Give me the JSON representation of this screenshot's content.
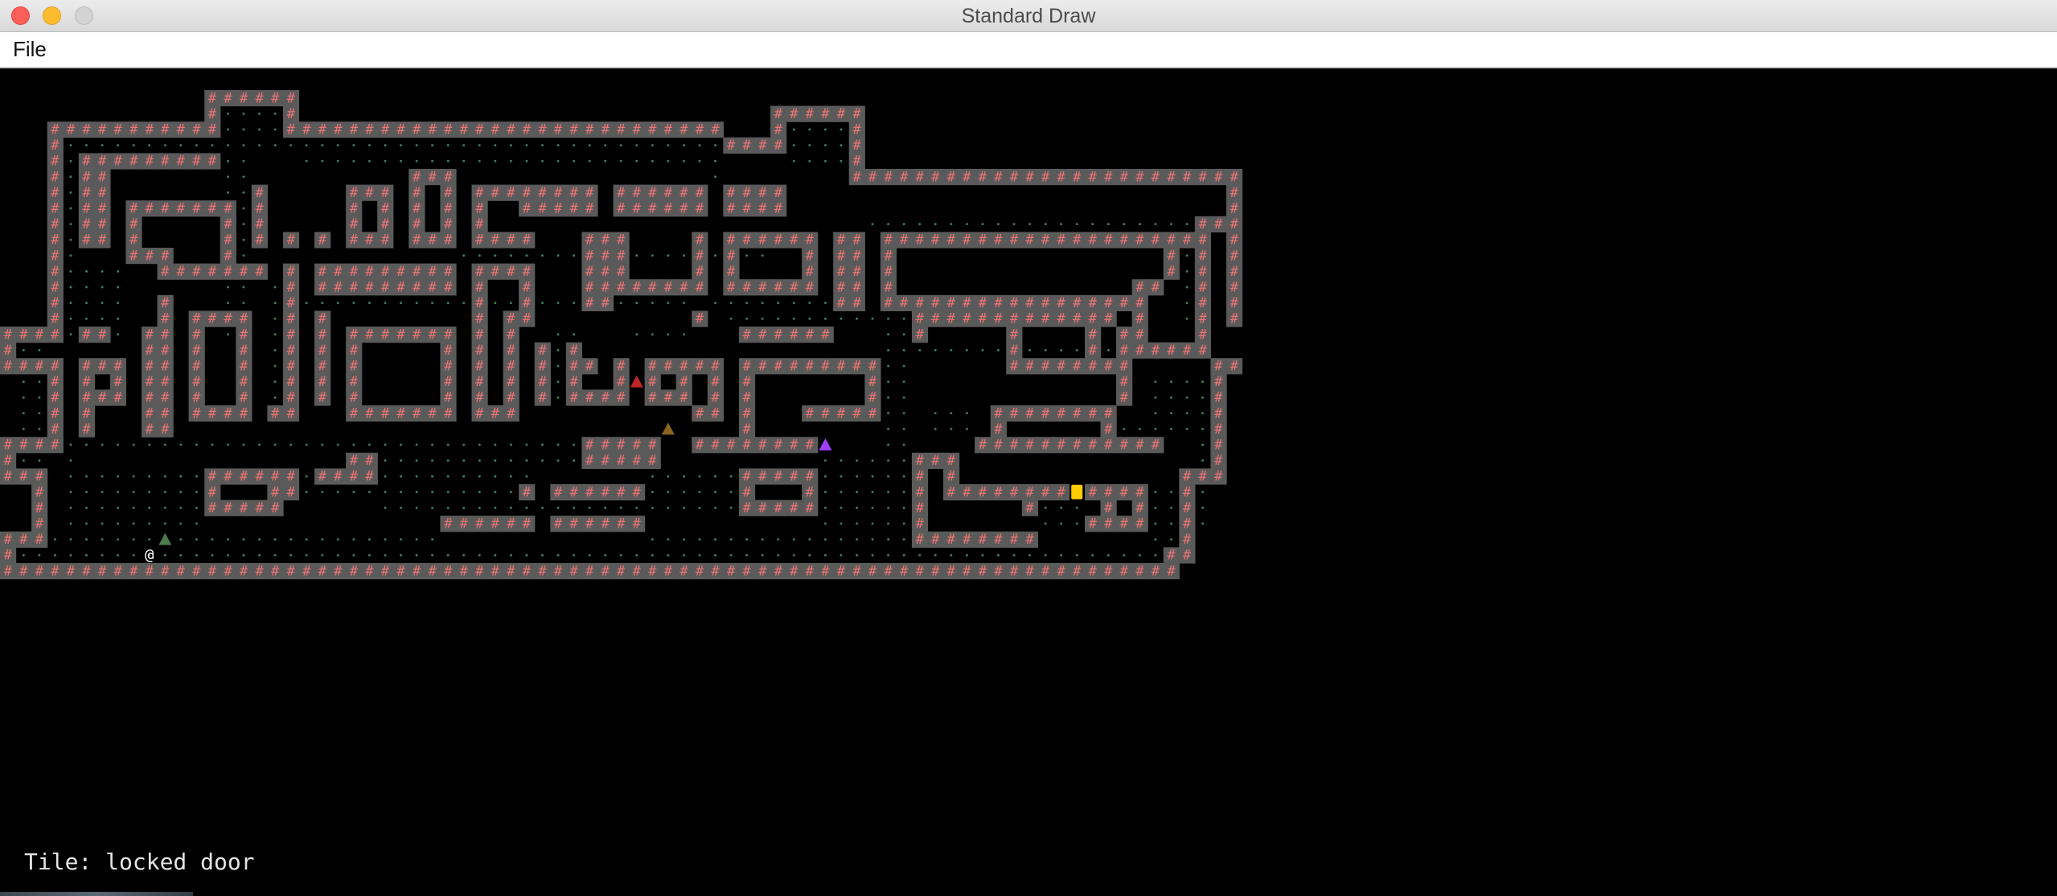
{
  "window": {
    "title": "Standard Draw"
  },
  "menu": {
    "items": [
      {
        "label": "File"
      }
    ]
  },
  "status": {
    "label": "Tile:",
    "value": "locked door",
    "text": "Tile: locked door"
  },
  "colors": {
    "wall_bg": "#5a5a5a",
    "wall_glyph": "#ea7474",
    "floor_dot": "#3d7a55",
    "player": "#ffffff",
    "door": "#ffcc00",
    "enemy_red": "#c02424",
    "enemy_brown": "#8a6420",
    "enemy_purple": "#a040ff",
    "enemy_green": "#4d7a4d"
  },
  "glyphs": {
    "wall": "#",
    "player": "@"
  },
  "map": {
    "cols": 80,
    "rows": 30,
    "rects": [
      [
        13,
        0,
        6,
        1
      ],
      [
        13,
        1,
        1,
        2
      ],
      [
        18,
        1,
        1,
        2
      ],
      [
        3,
        2,
        11,
        1
      ],
      [
        18,
        2,
        28,
        1
      ],
      [
        49,
        1,
        6,
        1
      ],
      [
        49,
        2,
        1,
        2
      ],
      [
        54,
        2,
        1,
        3
      ],
      [
        46,
        3,
        4,
        1
      ],
      [
        54,
        5,
        25,
        1
      ],
      [
        78,
        5,
        1,
        10
      ],
      [
        3,
        3,
        1,
        12
      ],
      [
        5,
        4,
        9,
        1
      ],
      [
        5,
        5,
        2,
        5
      ],
      [
        8,
        7,
        7,
        1
      ],
      [
        8,
        8,
        1,
        3
      ],
      [
        14,
        8,
        1,
        4
      ],
      [
        8,
        10,
        3,
        1
      ],
      [
        10,
        11,
        7,
        1
      ],
      [
        16,
        6,
        1,
        4
      ],
      [
        22,
        6,
        3,
        1
      ],
      [
        22,
        7,
        1,
        3
      ],
      [
        24,
        7,
        1,
        3
      ],
      [
        22,
        9,
        3,
        1
      ],
      [
        26,
        5,
        3,
        1
      ],
      [
        26,
        6,
        1,
        4
      ],
      [
        28,
        6,
        1,
        4
      ],
      [
        26,
        9,
        3,
        1
      ],
      [
        30,
        6,
        8,
        1
      ],
      [
        30,
        7,
        1,
        3
      ],
      [
        33,
        7,
        5,
        1
      ],
      [
        30,
        9,
        4,
        1
      ],
      [
        39,
        6,
        6,
        1
      ],
      [
        39,
        7,
        6,
        1
      ],
      [
        46,
        6,
        4,
        1
      ],
      [
        46,
        7,
        4,
        1
      ],
      [
        18,
        9,
        1,
        1
      ],
      [
        20,
        9,
        1,
        1
      ],
      [
        37,
        9,
        2,
        5
      ],
      [
        39,
        9,
        1,
        4
      ],
      [
        44,
        9,
        1,
        4
      ],
      [
        39,
        12,
        6,
        1
      ],
      [
        46,
        9,
        6,
        1
      ],
      [
        46,
        10,
        1,
        3
      ],
      [
        51,
        10,
        1,
        3
      ],
      [
        46,
        12,
        6,
        1
      ],
      [
        53,
        9,
        2,
        5
      ],
      [
        56,
        9,
        20,
        1
      ],
      [
        56,
        10,
        1,
        4
      ],
      [
        74,
        10,
        1,
        2
      ],
      [
        56,
        13,
        16,
        1
      ],
      [
        76,
        8,
        2,
        1
      ],
      [
        76,
        9,
        1,
        8
      ],
      [
        72,
        12,
        2,
        1
      ],
      [
        72,
        13,
        1,
        4
      ],
      [
        72,
        16,
        4,
        1
      ],
      [
        20,
        11,
        9,
        1
      ],
      [
        20,
        12,
        9,
        1
      ],
      [
        18,
        11,
        1,
        10
      ],
      [
        30,
        11,
        4,
        1
      ],
      [
        30,
        12,
        1,
        9
      ],
      [
        33,
        12,
        1,
        3
      ],
      [
        32,
        14,
        2,
        1
      ],
      [
        32,
        15,
        1,
        6
      ],
      [
        30,
        20,
        3,
        1
      ],
      [
        44,
        14,
        1,
        1
      ],
      [
        0,
        15,
        4,
        1
      ],
      [
        5,
        15,
        2,
        1
      ],
      [
        0,
        16,
        1,
        1
      ],
      [
        0,
        17,
        4,
        1
      ],
      [
        3,
        18,
        1,
        4
      ],
      [
        0,
        22,
        4,
        1
      ],
      [
        5,
        17,
        3,
        1
      ],
      [
        5,
        18,
        1,
        1
      ],
      [
        7,
        18,
        1,
        1
      ],
      [
        5,
        19,
        3,
        1
      ],
      [
        5,
        20,
        1,
        2
      ],
      [
        10,
        13,
        1,
        9
      ],
      [
        9,
        15,
        2,
        7
      ],
      [
        12,
        14,
        4,
        1
      ],
      [
        12,
        15,
        1,
        6
      ],
      [
        15,
        15,
        1,
        6
      ],
      [
        12,
        20,
        4,
        1
      ],
      [
        17,
        20,
        2,
        1
      ],
      [
        20,
        14,
        1,
        6
      ],
      [
        22,
        15,
        7,
        1
      ],
      [
        22,
        16,
        1,
        5
      ],
      [
        28,
        16,
        1,
        5
      ],
      [
        22,
        20,
        7,
        1
      ],
      [
        34,
        16,
        1,
        4
      ],
      [
        36,
        16,
        1,
        4
      ],
      [
        36,
        17,
        2,
        1
      ],
      [
        36,
        19,
        4,
        1
      ],
      [
        39,
        17,
        1,
        3
      ],
      [
        41,
        17,
        3,
        1
      ],
      [
        41,
        18,
        1,
        2
      ],
      [
        43,
        18,
        1,
        2
      ],
      [
        41,
        19,
        3,
        1
      ],
      [
        44,
        17,
        2,
        1
      ],
      [
        45,
        18,
        1,
        3
      ],
      [
        44,
        20,
        2,
        1
      ],
      [
        47,
        15,
        6,
        1
      ],
      [
        47,
        17,
        9,
        1
      ],
      [
        47,
        18,
        1,
        5
      ],
      [
        55,
        18,
        1,
        3
      ],
      [
        51,
        20,
        5,
        1
      ],
      [
        44,
        22,
        1,
        1
      ],
      [
        45,
        22,
        7,
        1
      ],
      [
        58,
        14,
        6,
        1
      ],
      [
        58,
        15,
        1,
        1
      ],
      [
        64,
        14,
        7,
        1
      ],
      [
        64,
        15,
        1,
        3
      ],
      [
        69,
        15,
        1,
        3
      ],
      [
        64,
        17,
        7,
        1
      ],
      [
        71,
        15,
        1,
        5
      ],
      [
        77,
        17,
        2,
        1
      ],
      [
        77,
        18,
        1,
        7
      ],
      [
        75,
        24,
        3,
        1
      ],
      [
        63,
        20,
        8,
        1
      ],
      [
        63,
        21,
        1,
        1
      ],
      [
        70,
        21,
        1,
        1
      ],
      [
        62,
        22,
        12,
        1
      ],
      [
        58,
        23,
        3,
        1
      ],
      [
        58,
        24,
        1,
        5
      ],
      [
        60,
        24,
        1,
        2
      ],
      [
        60,
        25,
        8,
        1
      ],
      [
        65,
        26,
        1,
        1
      ],
      [
        69,
        25,
        4,
        1
      ],
      [
        70,
        26,
        1,
        1
      ],
      [
        72,
        26,
        1,
        2
      ],
      [
        69,
        27,
        4,
        1
      ],
      [
        58,
        28,
        8,
        1
      ],
      [
        75,
        25,
        1,
        5
      ],
      [
        74,
        29,
        2,
        1
      ],
      [
        37,
        22,
        5,
        1
      ],
      [
        37,
        23,
        5,
        1
      ],
      [
        0,
        23,
        1,
        1
      ],
      [
        0,
        24,
        3,
        1
      ],
      [
        2,
        25,
        1,
        3
      ],
      [
        0,
        28,
        3,
        1
      ],
      [
        0,
        29,
        1,
        1
      ],
      [
        0,
        30,
        75,
        1
      ],
      [
        13,
        24,
        6,
        1
      ],
      [
        13,
        25,
        1,
        2
      ],
      [
        17,
        25,
        2,
        1
      ],
      [
        13,
        26,
        5,
        1
      ],
      [
        20,
        24,
        4,
        1
      ],
      [
        22,
        23,
        2,
        1
      ],
      [
        33,
        25,
        1,
        1
      ],
      [
        35,
        25,
        6,
        1
      ],
      [
        28,
        27,
        6,
        1
      ],
      [
        35,
        27,
        6,
        1
      ],
      [
        47,
        24,
        5,
        1
      ],
      [
        47,
        25,
        1,
        2
      ],
      [
        51,
        25,
        1,
        2
      ],
      [
        47,
        26,
        5,
        1
      ]
    ],
    "dot_rects": [
      [
        14,
        1,
        4,
        2
      ],
      [
        4,
        3,
        42,
        1
      ],
      [
        50,
        2,
        4,
        3
      ],
      [
        4,
        4,
        1,
        11
      ],
      [
        14,
        4,
        2,
        12
      ],
      [
        19,
        4,
        26,
        1
      ],
      [
        45,
        4,
        1,
        2
      ],
      [
        4,
        11,
        4,
        5
      ],
      [
        29,
        10,
        20,
        1
      ],
      [
        55,
        8,
        20,
        1
      ],
      [
        75,
        8,
        1,
        7
      ],
      [
        17,
        12,
        2,
        9
      ],
      [
        19,
        13,
        25,
        1
      ],
      [
        45,
        13,
        10,
        1
      ],
      [
        46,
        14,
        12,
        1
      ],
      [
        35,
        15,
        2,
        5
      ],
      [
        40,
        15,
        4,
        1
      ],
      [
        56,
        15,
        2,
        10
      ],
      [
        57,
        16,
        15,
        1
      ],
      [
        1,
        16,
        2,
        8
      ],
      [
        4,
        22,
        33,
        1
      ],
      [
        24,
        23,
        18,
        1
      ],
      [
        4,
        23,
        1,
        7
      ],
      [
        4,
        24,
        9,
        4
      ],
      [
        19,
        24,
        15,
        2
      ],
      [
        41,
        24,
        6,
        3
      ],
      [
        52,
        23,
        6,
        7
      ],
      [
        24,
        26,
        17,
        1
      ],
      [
        1,
        29,
        73,
        1
      ],
      [
        1,
        28,
        27,
        1
      ],
      [
        41,
        28,
        17,
        1
      ],
      [
        59,
        20,
        3,
        2
      ],
      [
        73,
        18,
        4,
        4
      ],
      [
        71,
        21,
        3,
        1
      ],
      [
        76,
        22,
        1,
        6
      ],
      [
        66,
        26,
        3,
        2
      ],
      [
        73,
        25,
        2,
        4
      ]
    ],
    "entities": [
      {
        "type": "player",
        "label": "@",
        "col": 9,
        "row": 29
      },
      {
        "type": "locked-door",
        "col": 68,
        "row": 25
      },
      {
        "type": "enemy-red",
        "col": 40,
        "row": 18
      },
      {
        "type": "enemy-brown",
        "col": 42,
        "row": 21
      },
      {
        "type": "enemy-purple",
        "col": 52,
        "row": 22
      },
      {
        "type": "enemy-green",
        "col": 10,
        "row": 28
      }
    ]
  }
}
